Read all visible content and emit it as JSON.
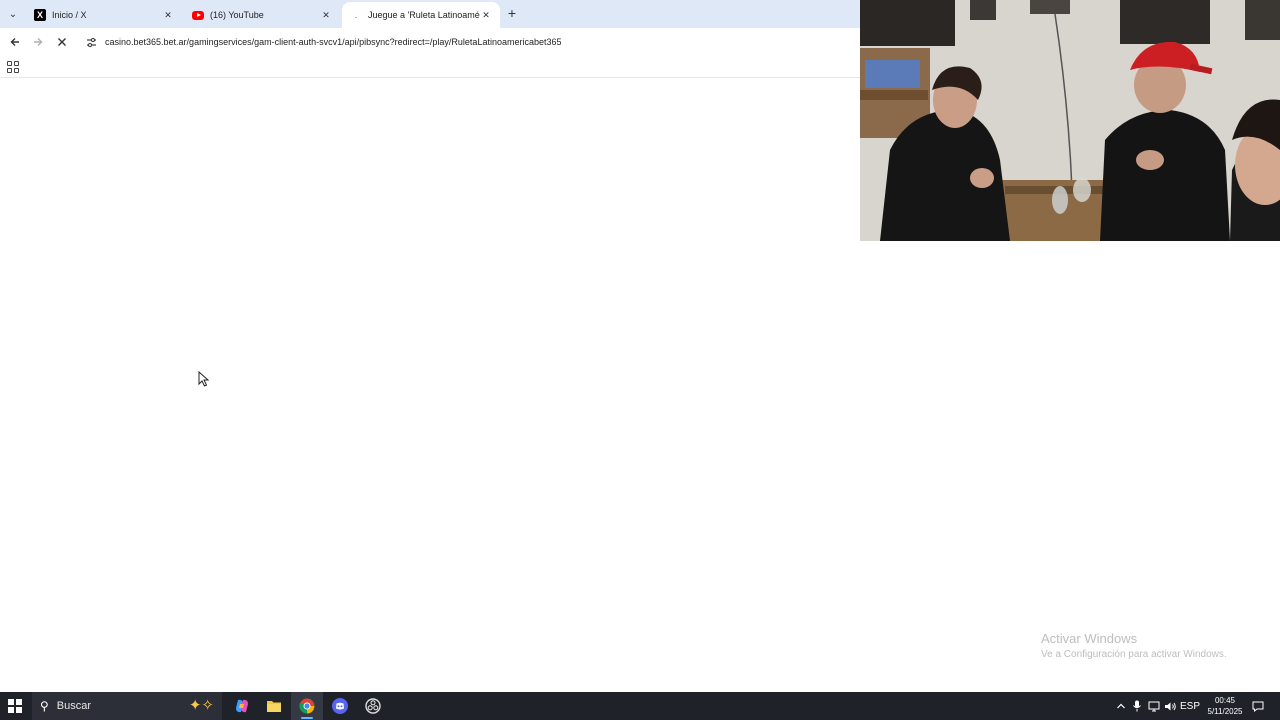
{
  "browser": {
    "tabs": [
      {
        "title": "Inicio / X",
        "favicon": "x-logo-icon",
        "active": false
      },
      {
        "title": "(16) YouTube",
        "favicon": "youtube-icon",
        "active": false
      },
      {
        "title": "Juegue a 'Ruleta Latinoamérica",
        "favicon": "loading-icon",
        "active": true
      }
    ],
    "address_bar": {
      "url": "casino.bet365.bet.ar/gamingservices/gam-client-auth-svcv1/api/pibsync?redirect=/play/RuletaLatinoamericabet365"
    }
  },
  "watermark": {
    "title": "Activar Windows",
    "subtitle": "Ve a Configuración para activar Windows."
  },
  "taskbar": {
    "search_placeholder": "Buscar",
    "tray": {
      "language": "ESP",
      "time": "00:45",
      "date": "5/11/2025"
    }
  },
  "colors": {
    "tabstrip": "#dfe8f7",
    "taskbar": "#1f2229",
    "watermark": "#bdbdbd"
  }
}
